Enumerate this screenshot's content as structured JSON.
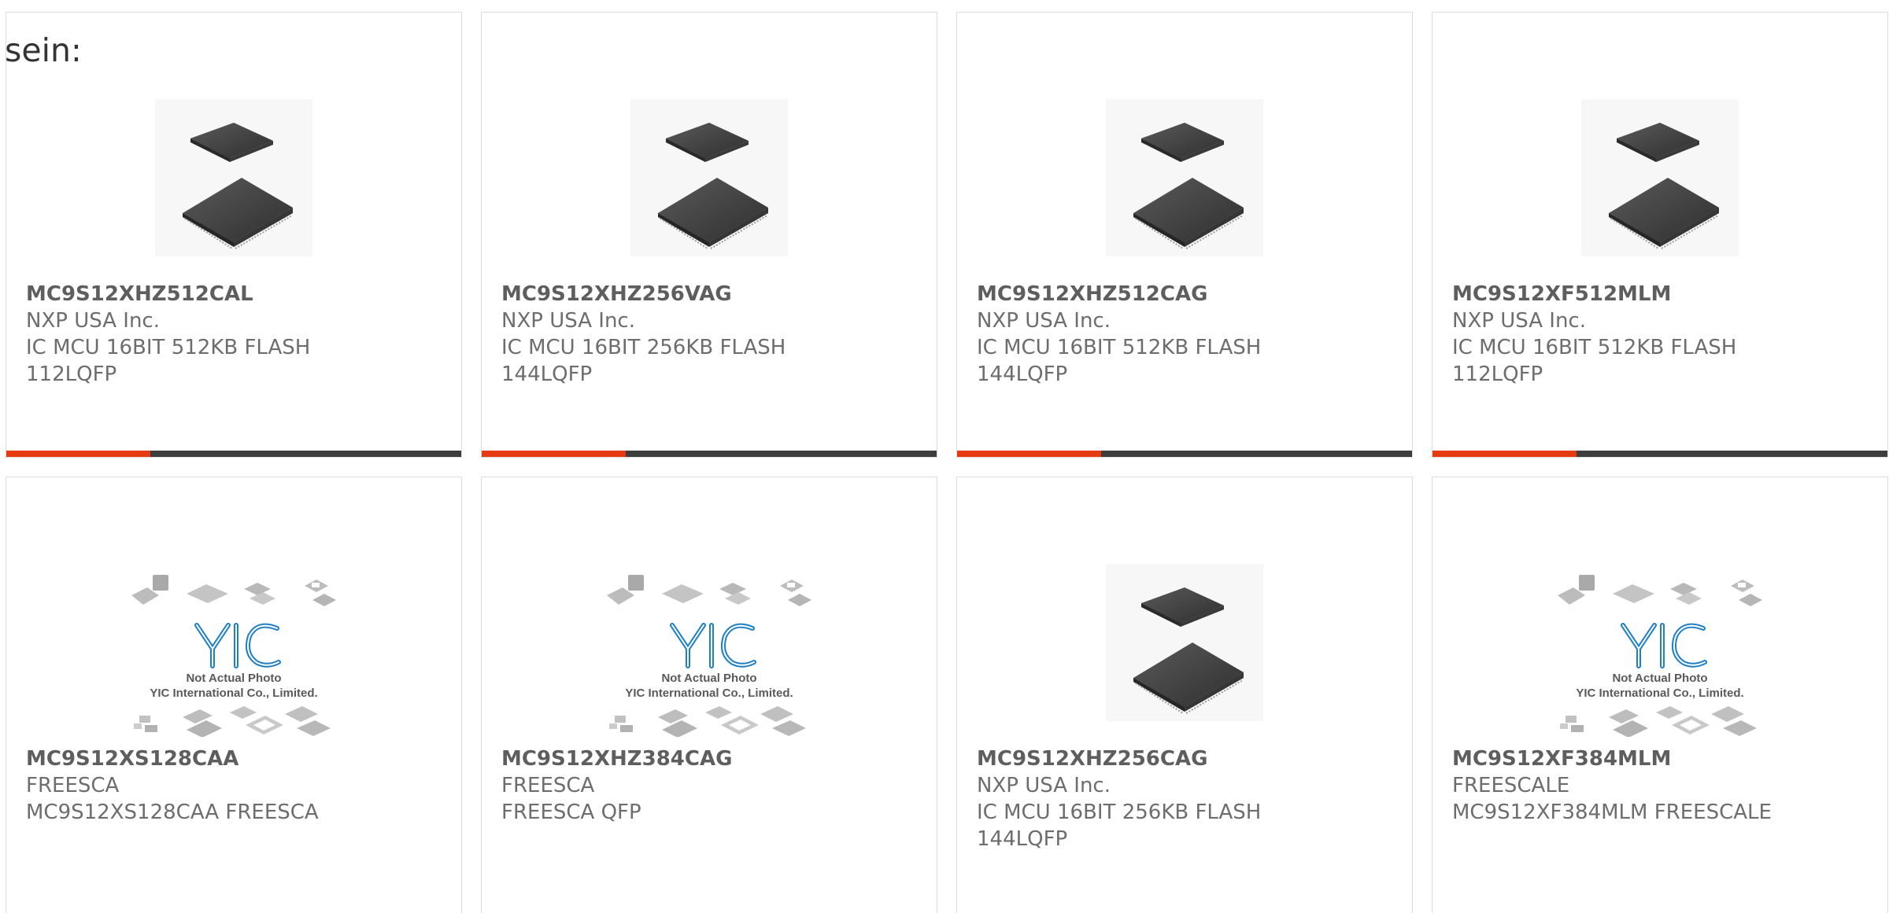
{
  "heading": "sein:",
  "placeholder": {
    "logo_text": "YIC",
    "line1": "Not Actual Photo",
    "line2": "YIC International Co., Limited."
  },
  "colors": {
    "accent": "#e63b12",
    "bar": "#3d3d3d",
    "chip": "#4a4a4a",
    "logo": "#1f7fc4"
  },
  "products": [
    {
      "part": "MC9S12XHZ512CAL",
      "manufacturer": "NXP USA Inc.",
      "desc1": "IC MCU 16BIT 512KB FLASH",
      "desc2": "112LQFP",
      "image": "qfp-chip-icon"
    },
    {
      "part": "MC9S12XHZ256VAG",
      "manufacturer": "NXP USA Inc.",
      "desc1": "IC MCU 16BIT 256KB FLASH",
      "desc2": "144LQFP",
      "image": "qfp-chip-icon"
    },
    {
      "part": "MC9S12XHZ512CAG",
      "manufacturer": "NXP USA Inc.",
      "desc1": "IC MCU 16BIT 512KB FLASH",
      "desc2": "144LQFP",
      "image": "qfp-chip-icon"
    },
    {
      "part": "MC9S12XF512MLM",
      "manufacturer": "NXP USA Inc.",
      "desc1": "IC MCU 16BIT 512KB FLASH",
      "desc2": "112LQFP",
      "image": "qfp-chip-icon"
    },
    {
      "part": "MC9S12XS128CAA",
      "manufacturer": "FREESCA",
      "desc1": "MC9S12XS128CAA FREESCA",
      "desc2": "",
      "image": "not-actual-photo-icon"
    },
    {
      "part": "MC9S12XHZ384CAG",
      "manufacturer": "FREESCA",
      "desc1": "FREESCA QFP",
      "desc2": "",
      "image": "not-actual-photo-icon"
    },
    {
      "part": "MC9S12XHZ256CAG",
      "manufacturer": "NXP USA Inc.",
      "desc1": "IC MCU 16BIT 256KB FLASH",
      "desc2": "144LQFP",
      "image": "qfp-chip-icon"
    },
    {
      "part": "MC9S12XF384MLM",
      "manufacturer": "FREESCALE",
      "desc1": "MC9S12XF384MLM FREESCALE",
      "desc2": "",
      "image": "not-actual-photo-icon"
    }
  ]
}
